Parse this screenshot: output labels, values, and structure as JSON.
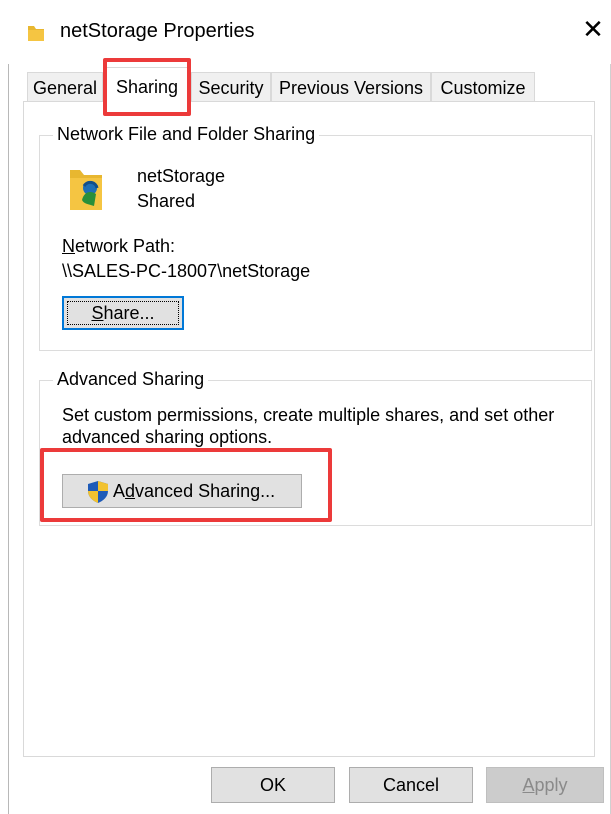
{
  "window": {
    "title": "netStorage Properties",
    "close_symbol": "✕"
  },
  "tabs": [
    {
      "label": "General",
      "active": false
    },
    {
      "label": "Sharing",
      "active": true
    },
    {
      "label": "Security",
      "active": false
    },
    {
      "label": "Previous Versions",
      "active": false
    },
    {
      "label": "Customize",
      "active": false
    }
  ],
  "network_sharing": {
    "group_label": "Network File and Folder Sharing",
    "folder_name": "netStorage",
    "status": "Shared",
    "network_path_label": "Network Path:",
    "network_path_label_hotkey": "N",
    "network_path_label_rest": "etwork Path:",
    "network_path": "\\\\SALES-PC-18007\\netStorage",
    "share_button": "Share...",
    "share_button_hotkey": "S",
    "share_button_rest": "hare..."
  },
  "advanced_sharing": {
    "group_label": "Advanced Sharing",
    "description_line1": "Set custom permissions, create multiple shares, and set other",
    "description_line2": "advanced sharing options.",
    "button_label": "Advanced Sharing...",
    "button_hotkey": "d",
    "button_prefix": "A",
    "button_rest": "vanced Sharing..."
  },
  "footer": {
    "ok": "OK",
    "cancel": "Cancel",
    "apply": "Apply",
    "apply_hotkey": "A",
    "apply_rest": "pply"
  },
  "colors": {
    "highlight": "#ec3a3a",
    "focus_border": "#0078d7",
    "folder_yellow": "#f5c542"
  },
  "icons": {
    "title": "folder-icon",
    "close": "close-icon",
    "shared_folder": "shared-folder-icon",
    "uac": "uac-shield-icon"
  }
}
